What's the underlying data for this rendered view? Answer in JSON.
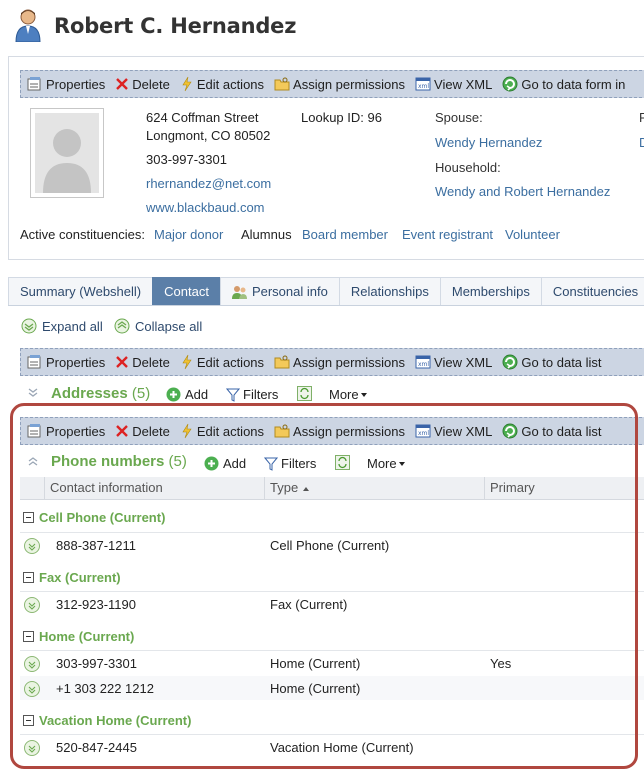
{
  "page": {
    "title": "Robert C. Hernandez"
  },
  "toolbar_top": {
    "properties": "Properties",
    "delete": "Delete",
    "edit_actions": "Edit actions",
    "assign_permissions": "Assign permissions",
    "view_xml": "View XML",
    "go_to": "Go to data form in"
  },
  "profile": {
    "address_line1": "624 Coffman Street",
    "address_line2": "Longmont, CO  80502",
    "phone": "303-997-3301",
    "email": "rhernandez@net.com",
    "website": "www.blackbaud.com",
    "lookup_id": "Lookup ID: 96",
    "spouse_label": "Spouse:",
    "spouse_value": "Wendy Hernandez",
    "household_label": "Household:",
    "household_value": "Wendy and Robert Hernandez",
    "cut_letter_1": "P",
    "cut_letter_2": "D",
    "constituencies_label": "Active constituencies:",
    "constituencies": [
      "Major donor",
      "Alumnus",
      "Board member",
      "Event registrant",
      "Volunteer"
    ]
  },
  "tabs": [
    "Summary (Webshell)",
    "Contact",
    "Personal info",
    "Relationships",
    "Memberships",
    "Constituencies"
  ],
  "expand": {
    "expand_all": "Expand all",
    "collapse_all": "Collapse all"
  },
  "toolbar_mid": {
    "properties": "Properties",
    "delete": "Delete",
    "edit_actions": "Edit actions",
    "assign_permissions": "Assign permissions",
    "view_xml": "View XML",
    "go_to": "Go to data list"
  },
  "addresses": {
    "title": "Addresses",
    "count": "(5)",
    "add": "Add",
    "filters": "Filters",
    "more": "More"
  },
  "toolbar_phone": {
    "properties": "Properties",
    "delete": "Delete",
    "edit_actions": "Edit actions",
    "assign_permissions": "Assign permissions",
    "view_xml": "View XML",
    "go_to": "Go to data list"
  },
  "phones": {
    "title": "Phone numbers",
    "count": "(5)",
    "add": "Add",
    "filters": "Filters",
    "more": "More",
    "columns": [
      "Contact information",
      "Type",
      "Primary"
    ],
    "groups": [
      {
        "name": "Cell Phone (Current)",
        "rows": [
          {
            "number": "888-387-1211",
            "type": "Cell Phone (Current)",
            "primary": ""
          }
        ]
      },
      {
        "name": "Fax (Current)",
        "rows": [
          {
            "number": "312-923-1190",
            "type": "Fax (Current)",
            "primary": ""
          }
        ]
      },
      {
        "name": "Home (Current)",
        "rows": [
          {
            "number": "303-997-3301",
            "type": "Home (Current)",
            "primary": "Yes"
          },
          {
            "number": "+1 303 222 1212",
            "type": "Home (Current)",
            "primary": ""
          }
        ]
      },
      {
        "name": "Vacation Home (Current)",
        "rows": [
          {
            "number": "520-847-2445",
            "type": "Vacation Home (Current)",
            "primary": ""
          }
        ]
      }
    ]
  },
  "colors": {
    "accent_green": "#6aa84f",
    "link_blue": "#3b6ea0",
    "tab_active": "#5b7fa8",
    "highlight_red": "#b0473f"
  }
}
